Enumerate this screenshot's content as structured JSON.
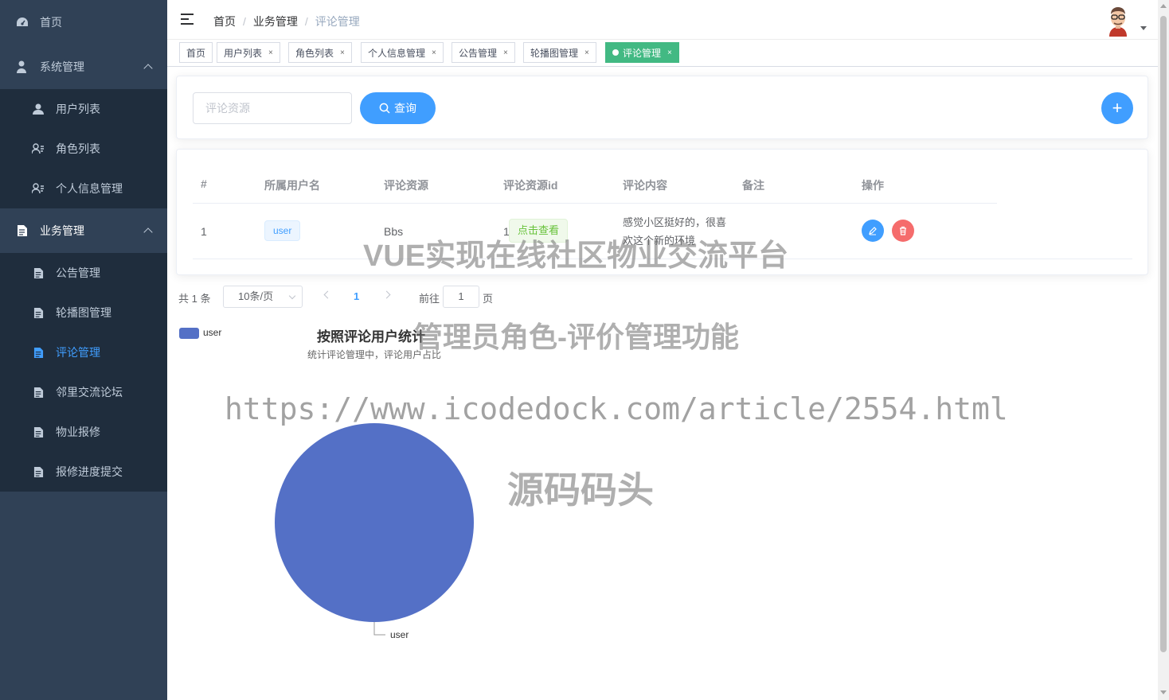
{
  "sidebar": {
    "items": [
      {
        "label": "首页",
        "icon": "dashboard-icon"
      },
      {
        "label": "系统管理",
        "icon": "user-admin-icon"
      },
      {
        "label": "用户列表",
        "icon": "user-icon"
      },
      {
        "label": "角色列表",
        "icon": "role-list-icon"
      },
      {
        "label": "个人信息管理",
        "icon": "role-list-icon"
      },
      {
        "label": "业务管理",
        "icon": "document-icon"
      },
      {
        "label": "公告管理",
        "icon": "document-icon"
      },
      {
        "label": "轮播图管理",
        "icon": "document-icon"
      },
      {
        "label": "评论管理",
        "icon": "document-icon"
      },
      {
        "label": "邻里交流论坛",
        "icon": "document-icon"
      },
      {
        "label": "物业报修",
        "icon": "document-icon"
      },
      {
        "label": "报修进度提交",
        "icon": "document-icon"
      }
    ],
    "active_color": "#409eff"
  },
  "navbar": {
    "breadcrumb": [
      "首页",
      "业务管理",
      "评论管理"
    ],
    "separator": "/"
  },
  "tags": [
    {
      "label": "首页",
      "closable": false
    },
    {
      "label": "用户列表",
      "closable": true
    },
    {
      "label": "角色列表",
      "closable": true
    },
    {
      "label": "个人信息管理",
      "closable": true
    },
    {
      "label": "公告管理",
      "closable": true
    },
    {
      "label": "轮播图管理",
      "closable": true
    },
    {
      "label": "评论管理",
      "closable": true,
      "active": true
    }
  ],
  "tag_close_glyph": "×",
  "search": {
    "placeholder": "评论资源",
    "query_label": "查询",
    "add_label": "+"
  },
  "table": {
    "headers": [
      "#",
      "所属用户名",
      "评论资源",
      "评论资源id",
      "评论内容",
      "备注",
      "操作"
    ],
    "rows": [
      {
        "index": "1",
        "username": "user",
        "resource": "Bbs",
        "resource_id": "1",
        "view_label": "点击查看",
        "content": "感觉小区挺好的，很喜欢这个新的环境",
        "remark": ""
      }
    ]
  },
  "pagination": {
    "total": "共 1 条",
    "page_size": "10条/页",
    "current": "1",
    "goto_label": "前往",
    "goto_value": "1",
    "goto_unit": "页"
  },
  "chart_data": {
    "type": "pie",
    "title": "按照评论用户统计",
    "subtitle": "统计评论管理中，评论用户占比",
    "legend": [
      "user"
    ],
    "legend_placement": "top-left",
    "slices": [
      {
        "name": "user",
        "value": 1,
        "color": "#5470c6"
      }
    ]
  },
  "watermarks": [
    "VUE实现在线社区物业交流平台",
    "管理员角色-评价管理功能",
    "https://www.icodedock.com/article/2554.html",
    "源码码头"
  ]
}
